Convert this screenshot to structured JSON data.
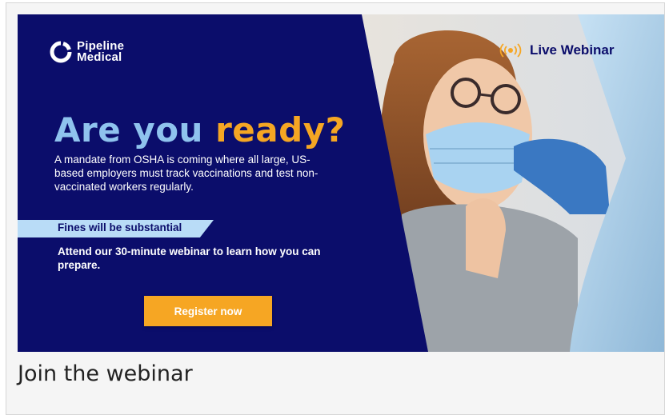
{
  "banner": {
    "brand": {
      "line1": "Pipeline",
      "line2": "Medical",
      "logo_icon": "pipeline-ring-icon"
    },
    "headline": {
      "part1": "Are you ",
      "part2": "ready?"
    },
    "intro": "A mandate from OSHA is coming where all large, US-based employers must track vaccinations and test non-vaccinated workers regularly.",
    "fines_label": "Fines will be substantial",
    "cta_text": "Attend our 30-minute webinar to learn how you can prepare.",
    "register_label": "Register now",
    "live_label": "Live Webinar",
    "live_icon": "broadcast-icon",
    "colors": {
      "navy": "#0b0d6b",
      "orange": "#f6a623",
      "light_blue": "#8fc3ee",
      "band_blue": "#b9dcf7"
    }
  },
  "caption": "Join the webinar"
}
